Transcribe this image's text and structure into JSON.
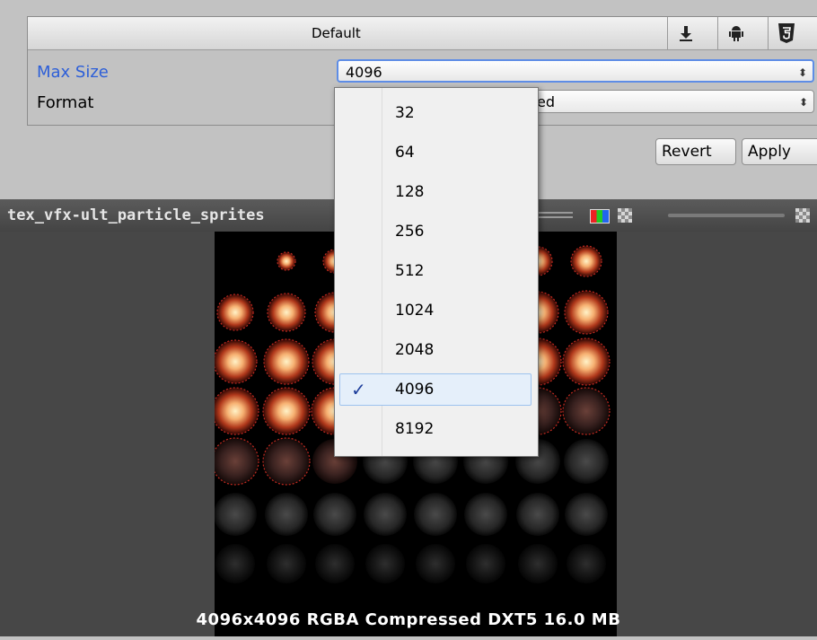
{
  "inspector": {
    "platform_tab": "Default",
    "platform_icons": [
      "download-icon",
      "android-icon",
      "html5-icon"
    ],
    "max_size_label": "Max Size",
    "max_size_value": "4096",
    "format_label": "Format",
    "format_value_fragment": "ed",
    "revert_label": "Revert",
    "apply_label": "Apply"
  },
  "preview": {
    "title": "tex_vfx-ult_particle_sprites",
    "info": "4096x4096  RGBA Compressed DXT5   16.0 MB"
  },
  "dropdown": {
    "options": [
      "32",
      "64",
      "128",
      "256",
      "512",
      "1024",
      "2048",
      "4096",
      "8192"
    ],
    "selected": "4096",
    "check_glyph": "✓"
  },
  "colors": {
    "label_accent": "#2d5fd8",
    "focus_border": "#5e8de6",
    "selection_bg": "#e5effa"
  }
}
